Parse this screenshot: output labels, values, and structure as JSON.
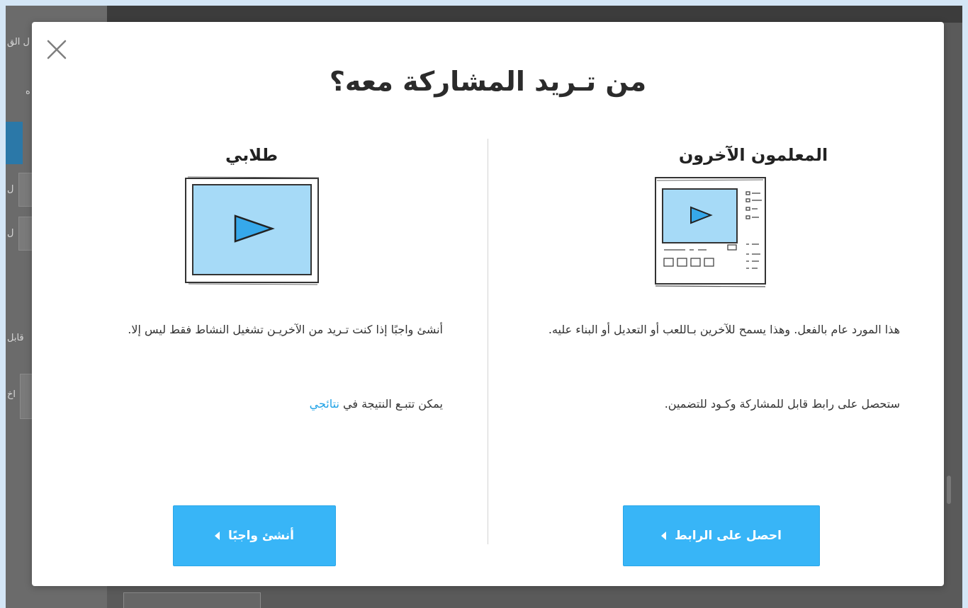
{
  "modal": {
    "title": "من تـريد المشاركة معه؟",
    "close_label": "×",
    "others": {
      "heading": "المعلمون الآخرون",
      "illustration_icon": "resource-page-sketch-icon",
      "para1": "هذا المورد عام بالفعل. وهذا يسمح للآخرين بـاللعب أو التعديل أو البناء عليه.",
      "para2": "ستحصل على رابط قابل للمشاركة وكـود للتضمين.",
      "button_label": "احصل على الرابط"
    },
    "students": {
      "heading": "طلابي",
      "illustration_icon": "video-player-sketch-icon",
      "para1": "أنشئ واجبًا إذا كنت تـريد من الآخريـن تشغيل النشاط فقط ليس إلا.",
      "para2_prefix": "يمكن تتبـع النتيجة في ",
      "para2_link": "نتائجي",
      "button_label": "أنشئ واجبًا"
    },
    "colors": {
      "accent": "#38b5f7",
      "link": "#1fa2e6",
      "illustration_fill": "#a6daf7"
    }
  },
  "background": {
    "side_texts": [
      "ل الق",
      "ه",
      "ل",
      "ل",
      "قابل",
      "اخ"
    ]
  }
}
